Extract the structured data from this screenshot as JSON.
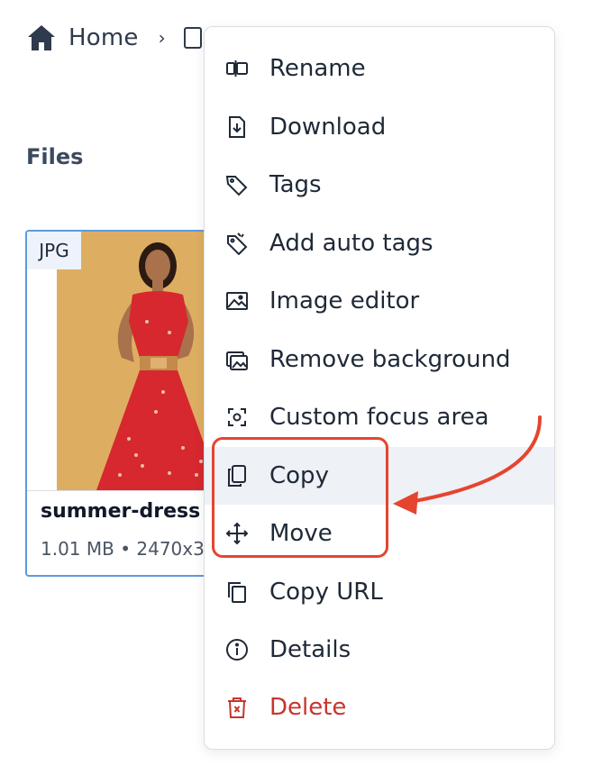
{
  "breadcrumb": {
    "home_label": "Home",
    "separator": "›"
  },
  "section": {
    "title": "Files"
  },
  "file": {
    "type_badge": "JPG",
    "name": "summer-dress",
    "meta": "1.01 MB • 2470x3"
  },
  "menu": {
    "items": [
      {
        "label": "Rename",
        "icon": "rename-icon"
      },
      {
        "label": "Download",
        "icon": "download-icon"
      },
      {
        "label": "Tags",
        "icon": "tag-icon"
      },
      {
        "label": "Add auto tags",
        "icon": "auto-tag-icon"
      },
      {
        "label": "Image editor",
        "icon": "image-icon"
      },
      {
        "label": "Remove background",
        "icon": "remove-background-icon"
      },
      {
        "label": "Custom focus area",
        "icon": "focus-area-icon"
      },
      {
        "label": "Copy",
        "icon": "copy-icon"
      },
      {
        "label": "Move",
        "icon": "move-icon"
      },
      {
        "label": "Copy URL",
        "icon": "copy-url-icon"
      },
      {
        "label": "Details",
        "icon": "info-icon"
      },
      {
        "label": "Delete",
        "icon": "trash-icon"
      }
    ]
  },
  "colors": {
    "accent_red": "#e5452f",
    "danger": "#c7352b",
    "selection_border": "#5b9bdf",
    "hover_bg": "#eef1f6",
    "photo_bg": "#ddae62"
  }
}
